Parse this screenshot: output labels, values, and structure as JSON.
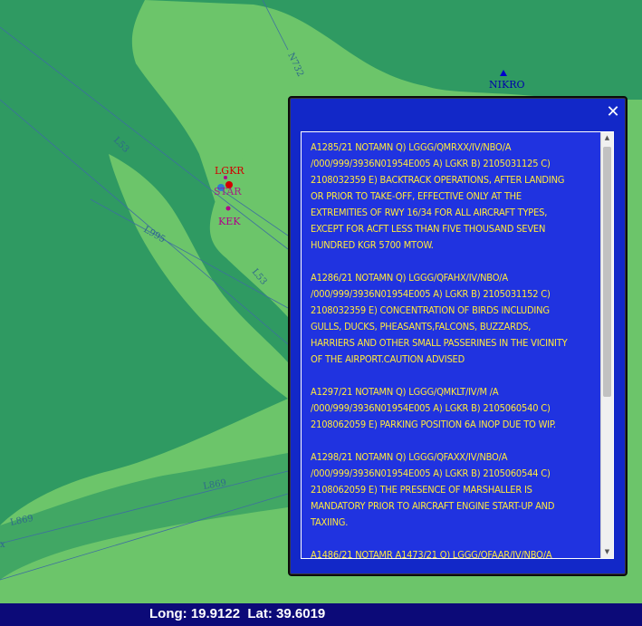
{
  "map": {
    "colors": {
      "land": "#6cc56a",
      "water": "#2f9a62",
      "airway": "#3d6fa0"
    },
    "airways": [
      "L53",
      "L995",
      "L53",
      "N732",
      "L869",
      "L869"
    ],
    "airway_edge_label": "x",
    "points": [
      {
        "name": "NIKRO",
        "symbol": "triangle",
        "color": "#0000cc"
      },
      {
        "name": "LGKR",
        "symbol": "circle",
        "color": "#d20000"
      },
      {
        "name": "KEK",
        "symbol": "circle",
        "color": "#b0008a"
      },
      {
        "name": "STAR",
        "symbol": "circle",
        "color": "#b0008a"
      }
    ]
  },
  "popup": {
    "close_icon": "close-icon",
    "close_glyph": "✕",
    "notams": [
      "A1285/21 NOTAMN Q) LGGG/QMRXX/IV/NBO/A\n/000/999/3936N01954E005 A) LGKR B) 2105031125 C)\n2108032359 E) BACKTRACK OPERATIONS, AFTER LANDING\nOR PRIOR TO TAKE-OFF, EFFECTIVE ONLY AT THE\nEXTREMITIES OF RWY 16/34 FOR ALL AIRCRAFT TYPES,\nEXCEPT FOR ACFT LESS THAN FIVE THOUSAND SEVEN\nHUNDRED KGR 5700 MTOW.",
      "A1286/21 NOTAMN Q) LGGG/QFAHX/IV/NBO/A\n/000/999/3936N01954E005 A) LGKR B) 2105031152 C)\n2108032359 E) CONCENTRATION OF BIRDS INCLUDING\nGULLS, DUCKS, PHEASANTS,FALCONS, BUZZARDS,\nHARRIERS AND OTHER SMALL PASSERINES IN THE VICINITY\nOF THE AIRPORT.CAUTION ADVISED",
      "A1297/21 NOTAMN Q) LGGG/QMKLT/IV/M /A\n/000/999/3936N01954E005 A) LGKR B) 2105060540 C)\n2108062059 E) PARKING POSITION 6A INOP DUE TO WIP.",
      "A1298/21 NOTAMN Q) LGGG/QFAXX/IV/NBO/A\n/000/999/3936N01954E005 A) LGKR B) 2105060544 C)\n2108062059 E) THE PRESENCE OF MARSHALLER IS\nMANDATORY PRIOR TO AIRCRAFT ENGINE START-UP AND\nTAXIING.",
      "A1486/21 NOTAMR A1473/21 Q) LGGG/QFAAR/IV/NBO/A"
    ],
    "scroll_up_glyph": "▲",
    "scroll_down_glyph": "▼"
  },
  "status": {
    "coords_text": "Long: 19.9122  Lat: 39.6019"
  }
}
